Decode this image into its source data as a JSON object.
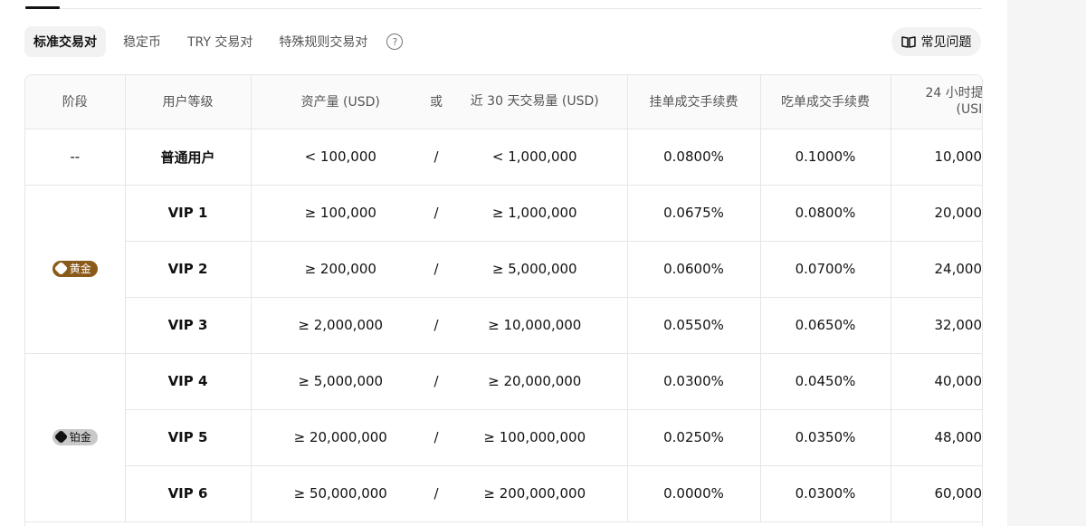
{
  "tabs": [
    {
      "label": "标准交易对",
      "active": true
    },
    {
      "label": "稳定币",
      "active": false
    },
    {
      "label": "TRY 交易对",
      "active": false
    },
    {
      "label": "特殊规则交易对",
      "active": false
    }
  ],
  "faq_label": "常见问题",
  "headers": {
    "stage": "阶段",
    "level": "用户等级",
    "asset": "资产量 (USD)",
    "or": "或",
    "volume": "近 30 天交易量 (USD)",
    "maker": "挂单成交手续费",
    "taker": "吃单成交手续费",
    "withdraw_line1": "24 小时提",
    "withdraw_line2": "(USI"
  },
  "badges": {
    "gold": "黄金",
    "platinum": "铂金"
  },
  "rows": [
    {
      "stage": "--",
      "level": "普通用户",
      "asset": "< 100,000",
      "or": "/",
      "volume": "< 1,000,000",
      "maker": "0.0800%",
      "taker": "0.1000%",
      "withdraw": "10,000"
    },
    {
      "level": "VIP 1",
      "asset": "≥ 100,000",
      "or": "/",
      "volume": "≥ 1,000,000",
      "maker": "0.0675%",
      "taker": "0.0800%",
      "withdraw": "20,000"
    },
    {
      "level": "VIP 2",
      "asset": "≥ 200,000",
      "or": "/",
      "volume": "≥ 5,000,000",
      "maker": "0.0600%",
      "taker": "0.0700%",
      "withdraw": "24,000"
    },
    {
      "level": "VIP 3",
      "asset": "≥ 2,000,000",
      "or": "/",
      "volume": "≥ 10,000,000",
      "maker": "0.0550%",
      "taker": "0.0650%",
      "withdraw": "32,000"
    },
    {
      "level": "VIP 4",
      "asset": "≥ 5,000,000",
      "or": "/",
      "volume": "≥ 20,000,000",
      "maker": "0.0300%",
      "taker": "0.0450%",
      "withdraw": "40,000"
    },
    {
      "level": "VIP 5",
      "asset": "≥ 20,000,000",
      "or": "/",
      "volume": "≥ 100,000,000",
      "maker": "0.0250%",
      "taker": "0.0350%",
      "withdraw": "48,000"
    },
    {
      "level": "VIP 6",
      "asset": "≥ 50,000,000",
      "or": "/",
      "volume": "≥ 200,000,000",
      "maker": "0.0000%",
      "taker": "0.0300%",
      "withdraw": "60,000"
    }
  ],
  "colors": {
    "gold_badge": "#8a5a1b",
    "platinum_badge": "#c9c9c9",
    "border": "#e6e6e6",
    "header_bg": "#fafafa"
  }
}
